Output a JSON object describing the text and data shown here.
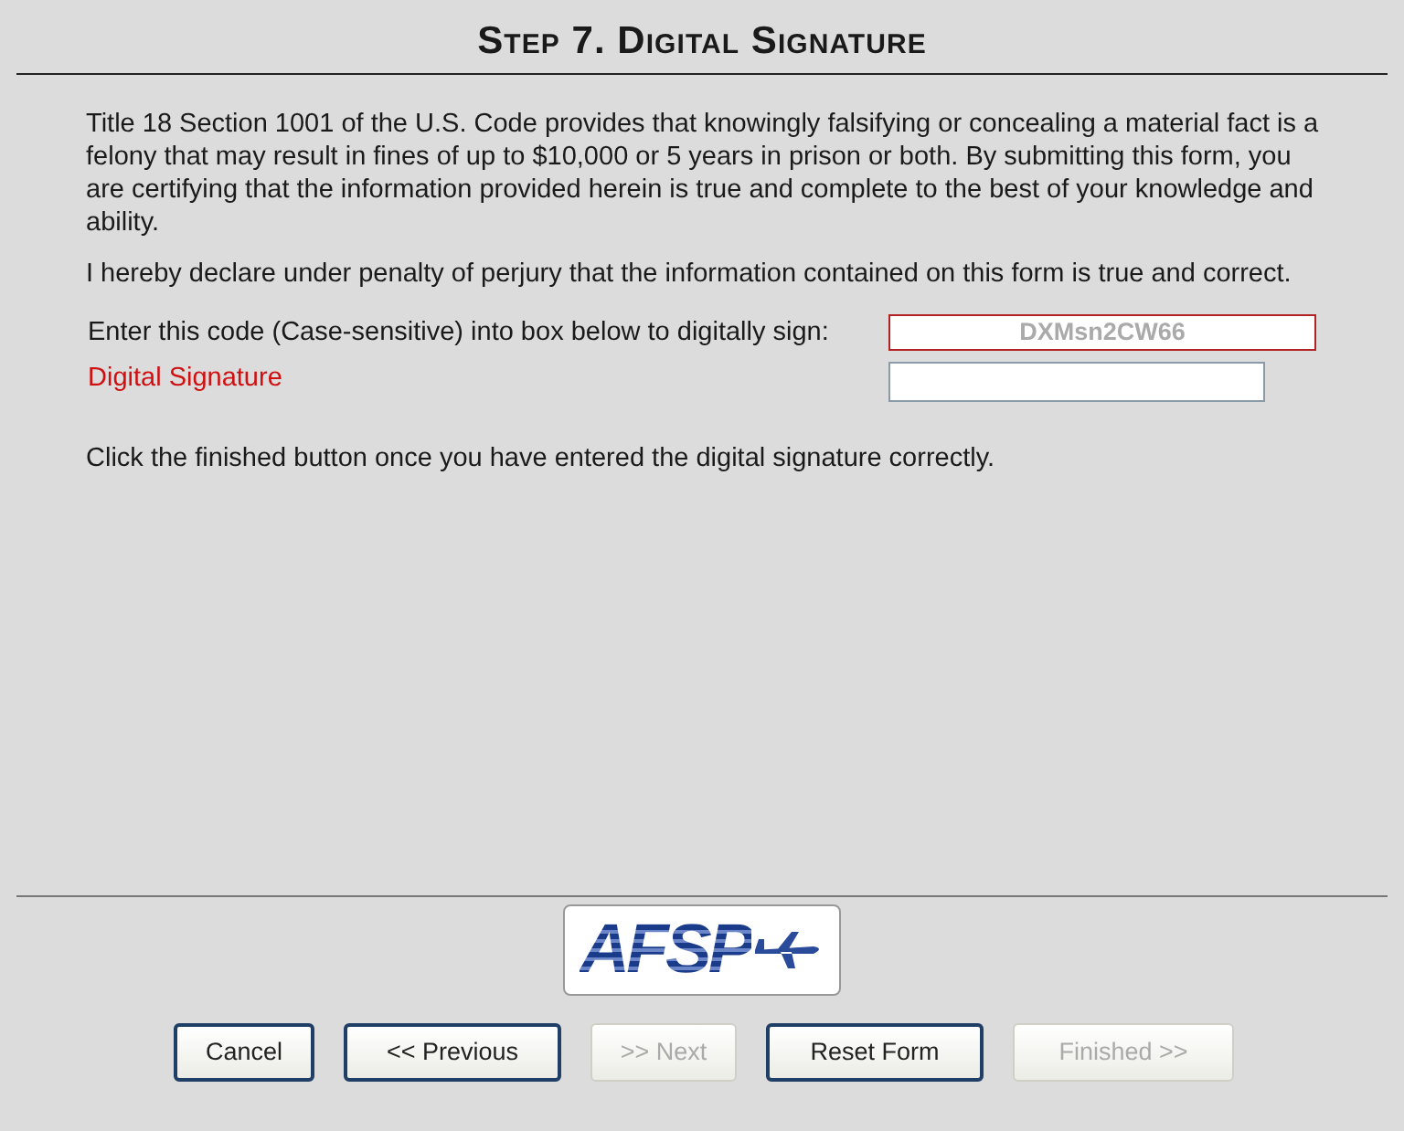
{
  "title": "Step 7. Digital Signature",
  "paragraphs": [
    "Title 18 Section 1001 of the U.S. Code provides that knowingly falsifying or concealing a material fact is a felony that may result in fines of up to $10,000 or 5 years in prison or both. By submitting this form, you are certifying that the information provided herein is true and complete to the best of your knowledge and ability.",
    "I hereby declare under penalty of perjury that the information contained on this form is true and correct."
  ],
  "code_row": {
    "label": "Enter this code (Case-sensitive) into box below to digitally sign:",
    "code": "DXMsn2CW66"
  },
  "signature": {
    "label": "Digital Signature"
  },
  "instruction": "Click the finished button once you have entered the digital signature correctly.",
  "logo": {
    "text": "AFSP"
  },
  "buttons": [
    {
      "label": "Cancel",
      "disabled": false
    },
    {
      "label": "<< Previous",
      "disabled": false
    },
    {
      "label": ">> Next",
      "disabled": true
    },
    {
      "label": "Reset Form",
      "disabled": false
    },
    {
      "label": "Finished >>",
      "disabled": true
    }
  ]
}
